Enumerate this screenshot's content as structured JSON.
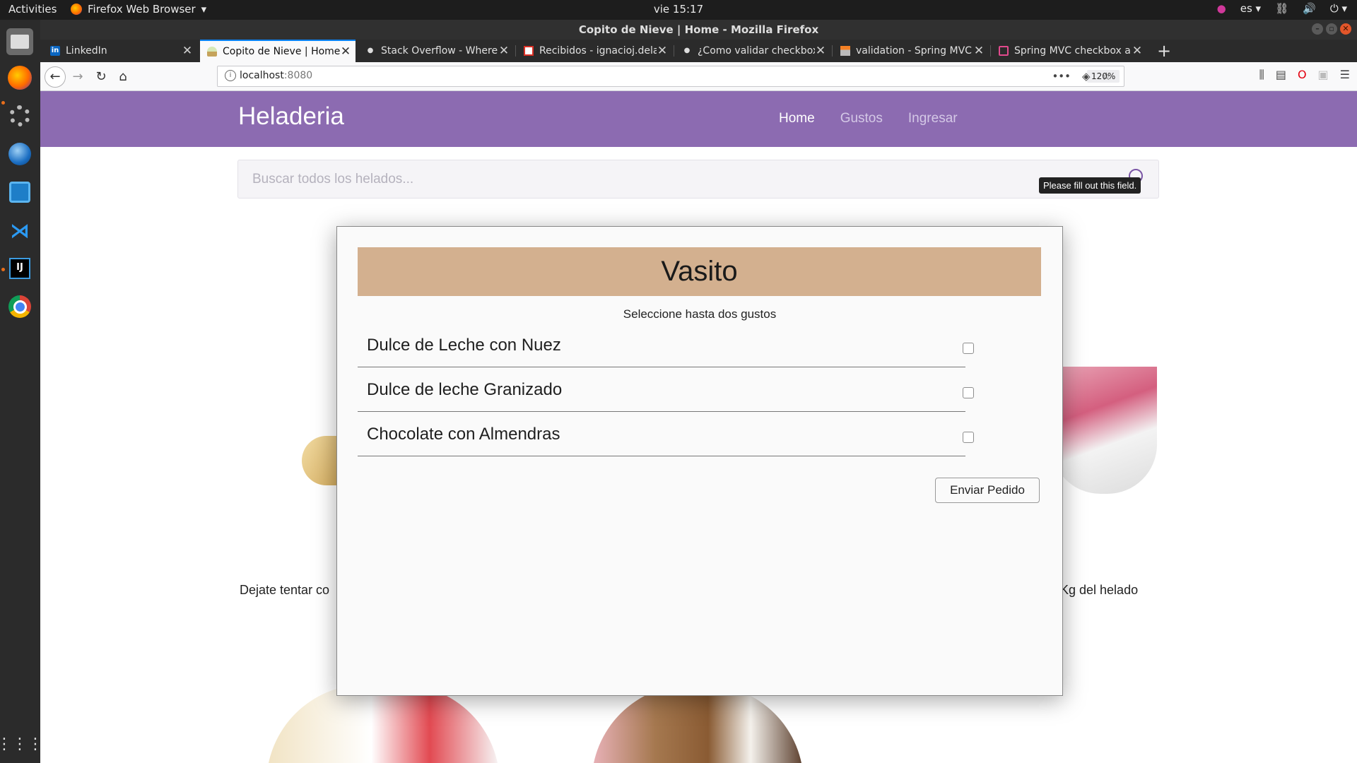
{
  "system": {
    "activities": "Activities",
    "app_menu": "Firefox Web Browser",
    "clock": "vie 15:17",
    "language": "es"
  },
  "window": {
    "title": "Copito de Nieve | Home - Mozilla Firefox"
  },
  "tabs": [
    {
      "label": "LinkedIn",
      "favicon": "linkedin-icon",
      "active": false
    },
    {
      "label": "Copito de Nieve | Home",
      "favicon": "icecream-icon",
      "active": true
    },
    {
      "label": "Stack Overflow - Where i",
      "favicon": "dot-icon",
      "active": false
    },
    {
      "label": "Recibidos - ignacioj.dela",
      "favicon": "gmail-icon",
      "active": false
    },
    {
      "label": "¿Como validar checkbox",
      "favicon": "dot-icon",
      "active": false
    },
    {
      "label": "validation - Spring MVC v",
      "favicon": "so-icon",
      "active": false
    },
    {
      "label": "Spring MVC checkbox an",
      "favicon": "page-icon",
      "active": false
    }
  ],
  "address_bar": {
    "host": "localhost",
    "port": ":8080",
    "zoom": "120%"
  },
  "site": {
    "brand": "Heladeria",
    "nav": [
      "Home",
      "Gustos",
      "Ingresar"
    ],
    "active_nav": "Home",
    "search_placeholder": "Buscar todos los helados...",
    "tooltip": "Please fill out this field.",
    "bg_text_left": "Dejate tentar co",
    "bg_text_right": "Kg del helado"
  },
  "modal": {
    "title": "Vasito",
    "subtitle": "Seleccione hasta dos gustos",
    "flavors": [
      {
        "name": "Dulce de Leche con Nuez",
        "checked": false
      },
      {
        "name": "Dulce de leche Granizado",
        "checked": false
      },
      {
        "name": "Chocolate con Almendras",
        "checked": false
      }
    ],
    "submit_label": "Enviar Pedido"
  },
  "colors": {
    "nav_purple": "#8c6bb1",
    "modal_header": "#d3b08f"
  }
}
